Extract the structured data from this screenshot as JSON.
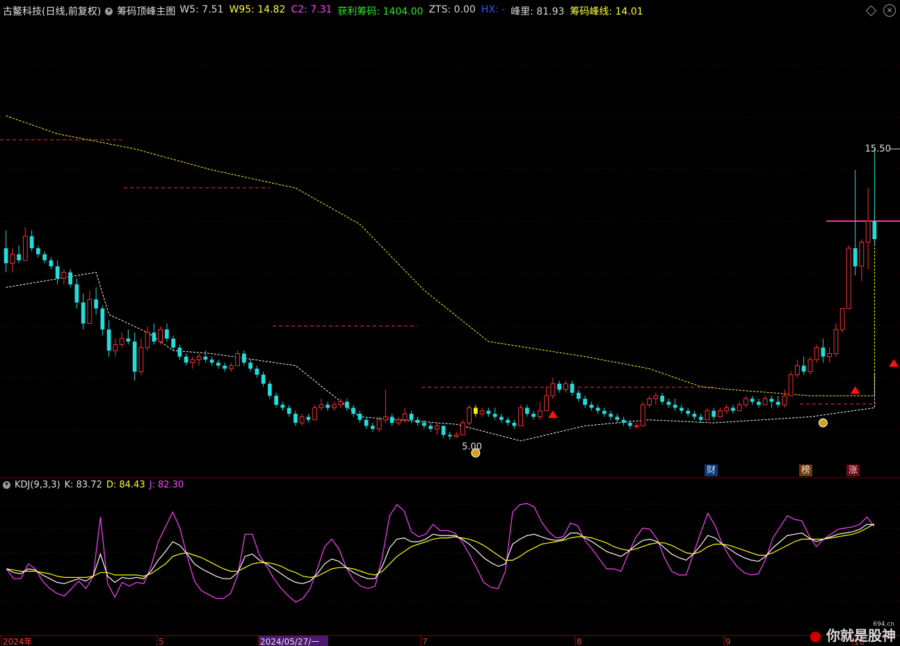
{
  "header": {
    "stock_name": "古鳌科技(日线,前复权)",
    "indicator": "筹码顶峰主图",
    "items": [
      {
        "label": "W5: 7.51",
        "color": "#d9d9d9"
      },
      {
        "label": "W95: 14.82",
        "color": "#ffff33"
      },
      {
        "label": "C2: 7.31",
        "color": "#ff44ff"
      },
      {
        "label": "获利筹码: 1404.00",
        "color": "#22ee22"
      },
      {
        "label": "ZTS: 0.00",
        "color": "#d9d9d9"
      },
      {
        "label": "HX: -",
        "color": "#3355ff"
      },
      {
        "label": "峰里: 81.93",
        "color": "#d9d9d9"
      },
      {
        "label": "筹码峰线: 14.01",
        "color": "#ffff33"
      }
    ]
  },
  "sub_header": {
    "title": "KDJ(9,3,3)",
    "k_label": "K: 83.72",
    "d_label": "D: 84.43",
    "j_label": "J: 82.30"
  },
  "annotations": {
    "high_label": "15.50",
    "low_label": "5.00",
    "marker_cai": "财",
    "marker_bang": "榜",
    "marker_zhang": "涨"
  },
  "x_axis": {
    "labels": [
      "2024年",
      "5",
      "2024/05/27/一",
      "7",
      "8",
      "9",
      "10"
    ]
  },
  "watermark": {
    "text": "你就是股神",
    "site": "694.cn"
  },
  "colors": {
    "up": "#ff3333",
    "down": "#22dddd",
    "k_line": "#ffffff",
    "d_line": "#ffff00",
    "j_line": "#ff44ff",
    "upper_line": "#ffff00",
    "lower_line": "#ffffff",
    "resistance": "#ff3333",
    "pink_level": "#ff3399"
  },
  "chart_data": {
    "type": "candlestick",
    "y_range": [
      4.6,
      19.8
    ],
    "candles": [
      [
        12.2,
        12.8,
        11.4,
        11.7
      ],
      [
        11.7,
        12.2,
        11.4,
        12.0
      ],
      [
        12.0,
        12.3,
        11.7,
        11.8
      ],
      [
        11.8,
        12.9,
        11.8,
        12.6
      ],
      [
        12.6,
        12.8,
        12.1,
        12.2
      ],
      [
        12.2,
        12.3,
        11.9,
        12.0
      ],
      [
        12.0,
        12.1,
        11.7,
        11.8
      ],
      [
        11.8,
        11.9,
        11.5,
        11.6
      ],
      [
        11.6,
        11.8,
        11.0,
        11.2
      ],
      [
        11.2,
        11.5,
        11.0,
        11.4
      ],
      [
        11.4,
        11.5,
        10.9,
        11.0
      ],
      [
        11.0,
        11.2,
        10.2,
        10.4
      ],
      [
        10.4,
        10.7,
        9.5,
        9.7
      ],
      [
        9.7,
        10.8,
        9.7,
        10.5
      ],
      [
        10.5,
        10.9,
        10.0,
        10.2
      ],
      [
        10.2,
        10.3,
        9.3,
        9.5
      ],
      [
        9.5,
        9.8,
        8.6,
        8.8
      ],
      [
        8.8,
        9.2,
        8.6,
        9.0
      ],
      [
        9.0,
        9.4,
        8.9,
        9.2
      ],
      [
        9.2,
        9.5,
        9.0,
        9.1
      ],
      [
        9.1,
        9.4,
        7.8,
        8.1
      ],
      [
        8.1,
        9.2,
        8.0,
        8.9
      ],
      [
        8.9,
        9.6,
        8.8,
        9.4
      ],
      [
        9.4,
        9.7,
        9.0,
        9.1
      ],
      [
        9.1,
        9.6,
        9.0,
        9.5
      ],
      [
        9.5,
        9.7,
        9.1,
        9.2
      ],
      [
        9.2,
        9.3,
        8.8,
        8.9
      ],
      [
        8.9,
        9.0,
        8.5,
        8.6
      ],
      [
        8.6,
        8.7,
        8.3,
        8.4
      ],
      [
        8.4,
        8.6,
        8.2,
        8.5
      ],
      [
        8.5,
        8.7,
        8.3,
        8.6
      ],
      [
        8.6,
        8.8,
        8.4,
        8.5
      ],
      [
        8.5,
        8.6,
        8.3,
        8.4
      ],
      [
        8.4,
        8.5,
        8.2,
        8.3
      ],
      [
        8.3,
        8.4,
        8.1,
        8.2
      ],
      [
        8.2,
        8.4,
        8.1,
        8.3
      ],
      [
        8.3,
        8.8,
        8.3,
        8.7
      ],
      [
        8.7,
        8.8,
        8.3,
        8.4
      ],
      [
        8.4,
        8.5,
        8.1,
        8.2
      ],
      [
        8.2,
        8.3,
        7.9,
        8.0
      ],
      [
        8.0,
        8.1,
        7.6,
        7.7
      ],
      [
        7.7,
        7.8,
        7.2,
        7.3
      ],
      [
        7.3,
        7.4,
        6.9,
        7.0
      ],
      [
        7.0,
        7.1,
        6.8,
        6.9
      ],
      [
        6.9,
        7.0,
        6.6,
        6.7
      ],
      [
        6.7,
        6.8,
        6.3,
        6.4
      ],
      [
        6.4,
        6.7,
        6.3,
        6.6
      ],
      [
        6.6,
        6.7,
        6.4,
        6.5
      ],
      [
        6.5,
        7.0,
        6.5,
        6.9
      ],
      [
        6.9,
        7.2,
        6.8,
        7.0
      ],
      [
        7.0,
        7.1,
        6.8,
        6.9
      ],
      [
        6.9,
        7.1,
        6.8,
        7.0
      ],
      [
        7.0,
        7.2,
        6.9,
        7.1
      ],
      [
        7.1,
        7.2,
        6.8,
        6.9
      ],
      [
        6.9,
        7.0,
        6.6,
        6.7
      ],
      [
        6.7,
        6.8,
        6.4,
        6.5
      ],
      [
        6.5,
        6.6,
        6.2,
        6.3
      ],
      [
        6.3,
        6.4,
        6.1,
        6.2
      ],
      [
        6.2,
        6.6,
        6.1,
        6.5
      ],
      [
        6.5,
        7.5,
        6.4,
        6.6
      ],
      [
        6.6,
        6.7,
        6.3,
        6.4
      ],
      [
        6.4,
        6.6,
        6.3,
        6.5
      ],
      [
        6.5,
        6.9,
        6.4,
        6.7
      ],
      [
        6.7,
        6.8,
        6.4,
        6.5
      ],
      [
        6.5,
        6.6,
        6.3,
        6.4
      ],
      [
        6.4,
        6.5,
        6.2,
        6.3
      ],
      [
        6.3,
        6.4,
        6.1,
        6.2
      ],
      [
        6.2,
        6.4,
        6.0,
        6.3
      ],
      [
        6.3,
        6.3,
        5.9,
        6.0
      ],
      [
        6.0,
        6.1,
        5.85,
        5.95
      ],
      [
        5.95,
        6.1,
        5.9,
        6.0
      ],
      [
        6.0,
        6.5,
        6.0,
        6.4
      ],
      [
        6.4,
        7.0,
        6.3,
        6.9
      ],
      [
        6.9,
        7.0,
        6.6,
        6.7
      ],
      [
        6.7,
        6.9,
        6.6,
        6.8
      ],
      [
        6.8,
        6.9,
        6.6,
        6.7
      ],
      [
        6.7,
        6.9,
        6.5,
        6.6
      ],
      [
        6.6,
        6.7,
        6.4,
        6.5
      ],
      [
        6.5,
        6.6,
        6.3,
        6.4
      ],
      [
        6.4,
        6.5,
        6.2,
        6.3
      ],
      [
        6.3,
        7.0,
        6.3,
        6.9
      ],
      [
        6.9,
        7.0,
        6.6,
        6.7
      ],
      [
        6.7,
        6.8,
        6.5,
        6.6
      ],
      [
        6.6,
        7.1,
        6.5,
        6.8
      ],
      [
        6.8,
        7.6,
        6.8,
        7.3
      ],
      [
        7.3,
        7.9,
        7.2,
        7.7
      ],
      [
        7.7,
        7.8,
        7.4,
        7.5
      ],
      [
        7.5,
        7.8,
        7.4,
        7.7
      ],
      [
        7.7,
        7.8,
        7.3,
        7.4
      ],
      [
        7.4,
        7.5,
        7.1,
        7.2
      ],
      [
        7.2,
        7.3,
        6.9,
        7.0
      ],
      [
        7.0,
        7.1,
        6.8,
        6.9
      ],
      [
        6.9,
        7.0,
        6.7,
        6.8
      ],
      [
        6.8,
        6.9,
        6.6,
        6.7
      ],
      [
        6.7,
        6.8,
        6.5,
        6.6
      ],
      [
        6.6,
        6.7,
        6.4,
        6.5
      ],
      [
        6.5,
        6.6,
        6.3,
        6.4
      ],
      [
        6.4,
        6.5,
        6.2,
        6.3
      ],
      [
        6.3,
        6.4,
        6.2,
        6.3
      ],
      [
        6.3,
        7.1,
        6.3,
        7.0
      ],
      [
        7.0,
        7.3,
        6.9,
        7.2
      ],
      [
        7.2,
        7.4,
        7.0,
        7.3
      ],
      [
        7.3,
        7.4,
        7.0,
        7.1
      ],
      [
        7.1,
        7.2,
        6.9,
        7.0
      ],
      [
        7.0,
        7.2,
        6.8,
        6.9
      ],
      [
        6.9,
        7.0,
        6.7,
        6.8
      ],
      [
        6.8,
        6.9,
        6.6,
        6.7
      ],
      [
        6.7,
        6.8,
        6.5,
        6.6
      ],
      [
        6.6,
        6.7,
        6.4,
        6.5
      ],
      [
        6.5,
        6.9,
        6.5,
        6.8
      ],
      [
        6.8,
        6.9,
        6.5,
        6.6
      ],
      [
        6.6,
        6.9,
        6.6,
        6.8
      ],
      [
        6.8,
        7.0,
        6.7,
        6.9
      ],
      [
        6.9,
        7.0,
        6.7,
        6.8
      ],
      [
        6.8,
        7.1,
        6.8,
        7.0
      ],
      [
        7.0,
        7.3,
        6.9,
        7.2
      ],
      [
        7.2,
        7.3,
        7.0,
        7.1
      ],
      [
        7.1,
        7.2,
        6.9,
        7.0
      ],
      [
        7.0,
        7.3,
        7.0,
        7.2
      ],
      [
        7.2,
        7.3,
        6.9,
        7.1
      ],
      [
        7.1,
        7.3,
        6.9,
        7.0
      ],
      [
        7.0,
        7.5,
        6.9,
        7.3
      ],
      [
        7.3,
        8.1,
        7.3,
        8.0
      ],
      [
        8.0,
        8.5,
        7.9,
        8.3
      ],
      [
        8.3,
        8.6,
        8.0,
        8.1
      ],
      [
        8.1,
        8.6,
        8.0,
        8.5
      ],
      [
        8.5,
        9.0,
        8.4,
        8.9
      ],
      [
        8.9,
        9.2,
        8.4,
        8.6
      ],
      [
        8.6,
        8.9,
        8.4,
        8.7
      ],
      [
        8.7,
        9.7,
        8.6,
        9.5
      ],
      [
        9.5,
        10.2,
        9.4,
        10.2
      ],
      [
        10.2,
        12.3,
        10.2,
        12.2
      ],
      [
        12.2,
        14.8,
        11.3,
        11.6
      ],
      [
        11.6,
        12.5,
        11.1,
        12.4
      ],
      [
        12.4,
        14.2,
        11.5,
        13.1
      ],
      [
        13.1,
        15.5,
        12.3,
        12.5
      ]
    ],
    "k": [
      48,
      45,
      44,
      48,
      47,
      43,
      40,
      37,
      36,
      38,
      40,
      38,
      42,
      60,
      42,
      37,
      41,
      40,
      41,
      40,
      46,
      55,
      62,
      70,
      67,
      60,
      52,
      48,
      45,
      42,
      40,
      40,
      45,
      58,
      60,
      55,
      52,
      48,
      44,
      40,
      37,
      36,
      38,
      44,
      52,
      56,
      54,
      49,
      45,
      42,
      40,
      40,
      50,
      65,
      72,
      73,
      70,
      70,
      72,
      76,
      75,
      75,
      75,
      72,
      68,
      63,
      57,
      53,
      50,
      52,
      68,
      72,
      75,
      76,
      74,
      72,
      71,
      72,
      77,
      77,
      73,
      70,
      66,
      62,
      60,
      58,
      62,
      67,
      71,
      72,
      70,
      65,
      60,
      57,
      55,
      60,
      67,
      75,
      73,
      68,
      64,
      60,
      57,
      55,
      54,
      58,
      65,
      70,
      75,
      76,
      77,
      73,
      70,
      72,
      74,
      76,
      77,
      78,
      80,
      84,
      83.72
    ],
    "d": [
      48,
      47,
      46,
      46,
      46,
      45,
      44,
      42,
      41,
      41,
      41,
      41,
      42,
      45,
      45,
      43,
      43,
      43,
      43,
      42,
      44,
      48,
      52,
      58,
      60,
      61,
      59,
      57,
      54,
      51,
      48,
      46,
      46,
      49,
      52,
      53,
      53,
      52,
      50,
      47,
      45,
      42,
      41,
      42,
      45,
      48,
      49,
      49,
      48,
      46,
      44,
      43,
      46,
      52,
      58,
      62,
      66,
      68,
      70,
      72,
      73,
      73,
      74,
      73,
      72,
      70,
      67,
      63,
      59,
      55,
      55,
      58,
      62,
      65,
      68,
      69,
      70,
      71,
      73,
      74,
      74,
      73,
      71,
      69,
      66,
      64,
      63,
      64,
      66,
      68,
      69,
      69,
      67,
      64,
      61,
      60,
      62,
      66,
      68,
      68,
      67,
      65,
      63,
      61,
      59,
      59,
      61,
      64,
      67,
      70,
      72,
      72,
      72,
      72,
      73,
      74,
      75,
      76,
      78,
      81,
      84.43
    ],
    "j": [
      48,
      40,
      40,
      52,
      48,
      38,
      32,
      28,
      26,
      32,
      38,
      32,
      42,
      90,
      36,
      25,
      37,
      34,
      37,
      36,
      50,
      70,
      82,
      94,
      81,
      58,
      38,
      30,
      27,
      24,
      24,
      28,
      43,
      76,
      76,
      59,
      50,
      40,
      32,
      26,
      21,
      24,
      32,
      48,
      66,
      72,
      64,
      49,
      39,
      34,
      32,
      34,
      58,
      91,
      100,
      95,
      78,
      74,
      76,
      84,
      79,
      79,
      77,
      70,
      60,
      49,
      37,
      33,
      32,
      46,
      94,
      100,
      101,
      98,
      86,
      78,
      73,
      74,
      85,
      83,
      71,
      64,
      56,
      48,
      48,
      46,
      60,
      73,
      81,
      80,
      72,
      57,
      46,
      43,
      43,
      60,
      77,
      93,
      83,
      68,
      58,
      50,
      45,
      43,
      44,
      56,
      73,
      82,
      91,
      88,
      87,
      75,
      66,
      72,
      76,
      80,
      81,
      82,
      84,
      90,
      82.3
    ],
    "kdj_range": [
      -5,
      110
    ]
  }
}
